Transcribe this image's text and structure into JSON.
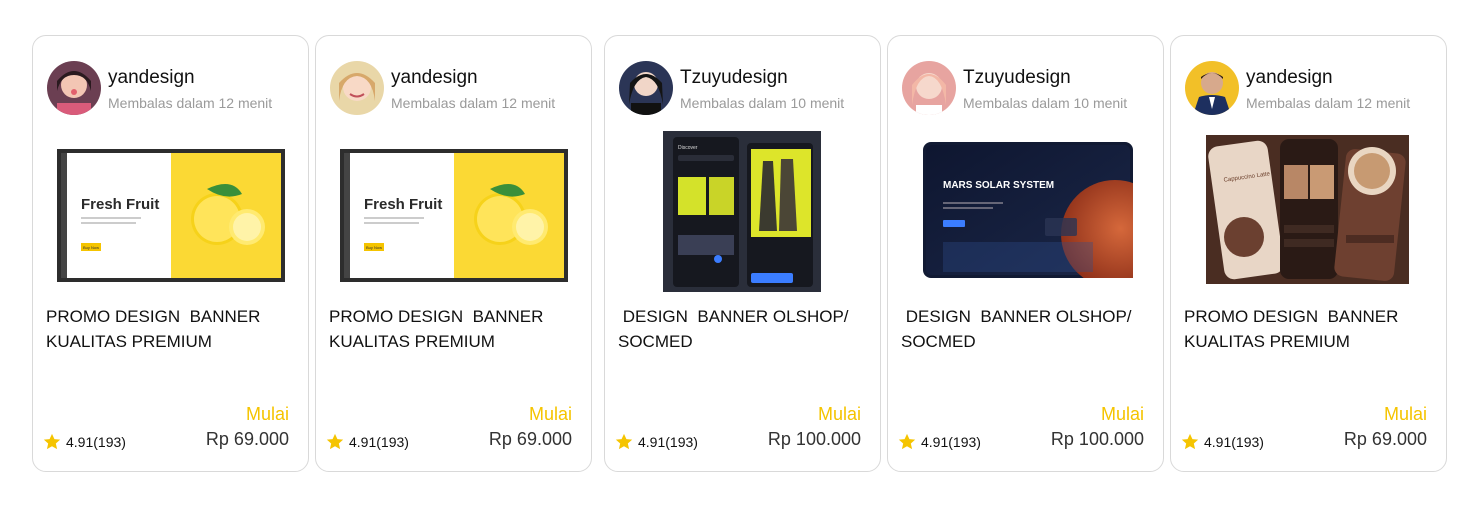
{
  "colors": {
    "accent": "#f5c400",
    "border": "#d9d9d9",
    "muted_text": "#9a9a9a"
  },
  "cards": [
    {
      "seller": "yandesign",
      "reply_time": "Membalas dalam 12 menit",
      "title": "PROMO DESIGN  BANNER KUALITAS PREMIUM",
      "thumbnail_text": {
        "headline": "Fresh Fruit",
        "button": "Buy Now"
      },
      "start_label": "Mulai",
      "price": "Rp 69.000",
      "rating": "4.91(193)"
    },
    {
      "seller": "yandesign",
      "reply_time": "Membalas dalam 12 menit",
      "title": "PROMO DESIGN  BANNER KUALITAS PREMIUM",
      "thumbnail_text": {
        "headline": "Fresh Fruit",
        "button": "Buy Now"
      },
      "start_label": "Mulai",
      "price": "Rp 69.000",
      "rating": "4.91(193)"
    },
    {
      "seller": "Tzuyudesign",
      "reply_time": "Membalas dalam 10 menit",
      "title": " DESIGN  BANNER OLSHOP/ SOCMED",
      "thumbnail_text": {
        "headline": "Discover"
      },
      "start_label": "Mulai",
      "price": "Rp 100.000",
      "rating": "4.91(193)"
    },
    {
      "seller": "Tzuyudesign",
      "reply_time": "Membalas dalam 10 menit",
      "title": " DESIGN  BANNER OLSHOP/ SOCMED",
      "thumbnail_text": {
        "headline": "MARS SOLAR SYSTEM"
      },
      "start_label": "Mulai",
      "price": "Rp 100.000",
      "rating": "4.91(193)"
    },
    {
      "seller": "yandesign",
      "reply_time": "Membalas dalam 12 menit",
      "title": "PROMO DESIGN  BANNER KUALITAS PREMIUM",
      "thumbnail_text": {
        "headline": "Cappuccino Latte"
      },
      "start_label": "Mulai",
      "price": "Rp 69.000",
      "rating": "4.91(193)"
    }
  ]
}
